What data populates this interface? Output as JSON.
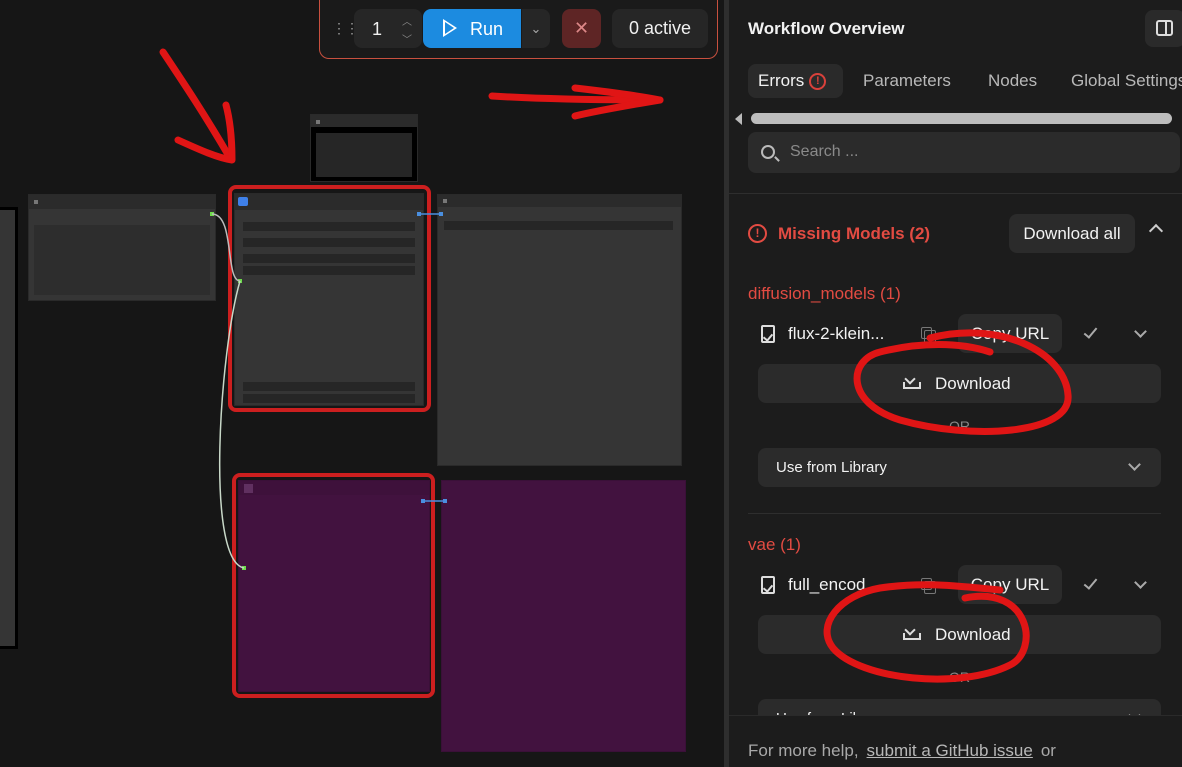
{
  "toolbar": {
    "queue_count": "1",
    "run_label": "Run",
    "active_label": "0 active"
  },
  "panel": {
    "title": "Workflow Overview",
    "tabs": [
      {
        "label": "Errors",
        "active": true
      },
      {
        "label": "Parameters"
      },
      {
        "label": "Nodes"
      },
      {
        "label": "Global Settings"
      }
    ],
    "search_placeholder": "Search ...",
    "missing_models": {
      "title": "Missing Models (2)",
      "download_all_label": "Download all",
      "groups": [
        {
          "category": "diffusion_models (1)",
          "file": "flux-2-klein...",
          "copy_url_label": "Copy URL",
          "download_label": "Download",
          "or_label": "OR",
          "library_label": "Use from Library"
        },
        {
          "category": "vae (1)",
          "file": "full_encod",
          "copy_url_label": "Copy URL",
          "download_label": "Download",
          "or_label": "OR",
          "library_label": "Use from Library"
        }
      ]
    },
    "footer": {
      "prefix": "For more help,",
      "link": "submit a GitHub issue",
      "suffix": "or"
    }
  },
  "colors": {
    "accent": "#1c8be0",
    "error": "#e24b42",
    "annotation": "#e01515",
    "node_purple": "#42123f"
  },
  "icons": [
    "drag-handle-icon",
    "play-icon",
    "chevron-down-icon",
    "close-icon",
    "sidebar-toggle-icon",
    "error-circle-icon",
    "search-icon",
    "file-check-icon",
    "copy-icon",
    "check-icon",
    "download-icon",
    "chevron-up-icon"
  ]
}
